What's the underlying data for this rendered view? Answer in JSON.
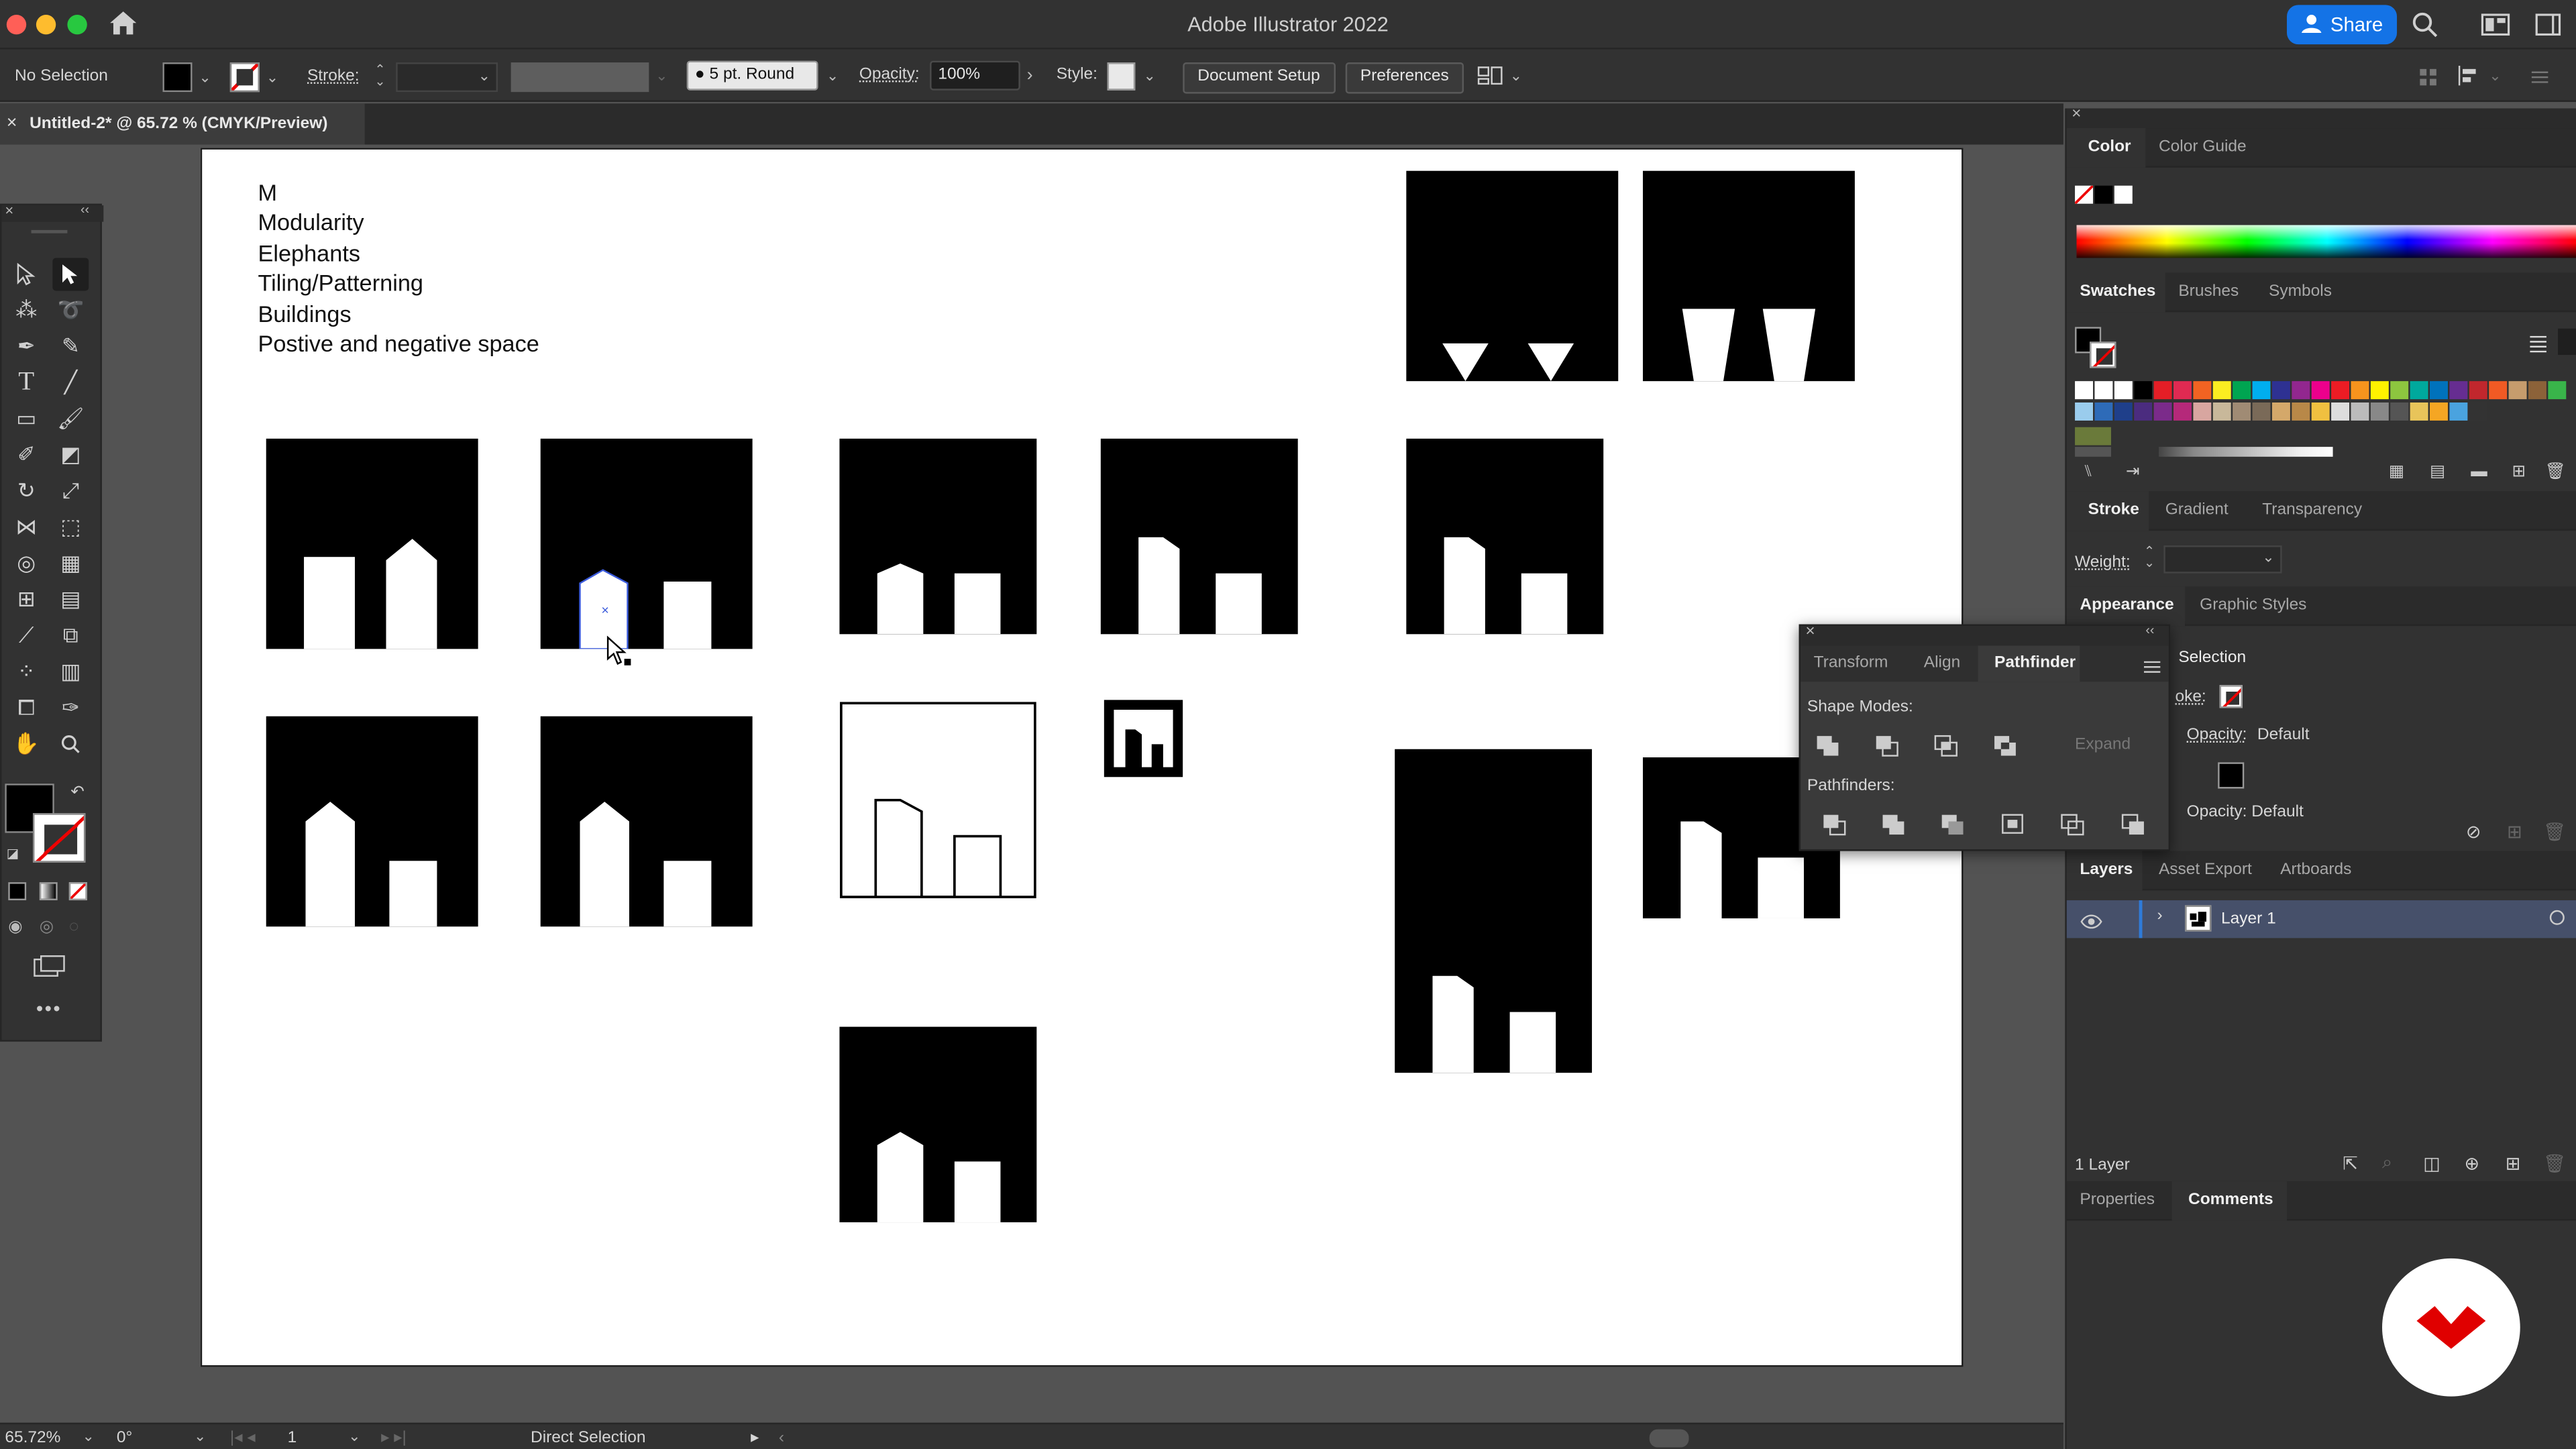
{
  "app": {
    "title": "Adobe Illustrator 2022",
    "share_label": "Share"
  },
  "control": {
    "selection": "No Selection",
    "stroke_label": "Stroke:",
    "brush": "5 pt. Round",
    "opacity_label": "Opacity:",
    "opacity_value": "100%",
    "style_label": "Style:",
    "document_setup": "Document Setup",
    "preferences": "Preferences"
  },
  "document": {
    "tab_title": "Untitled-2* @ 65.72 % (CMYK/Preview)"
  },
  "artboard": {
    "notes": [
      "M",
      "Modularity",
      "Elephants",
      "Tiling/Patterning",
      "Buildings",
      "Postive and negative space"
    ]
  },
  "color_panel": {
    "tabs": [
      "Color",
      "Color Guide"
    ]
  },
  "swatches_panel": {
    "tabs": [
      "Swatches",
      "Brushes",
      "Symbols"
    ]
  },
  "stroke_panel": {
    "tabs": [
      "Stroke",
      "Gradient",
      "Transparency"
    ],
    "weight_label": "Weight:"
  },
  "appearance_panel": {
    "tabs": [
      "Appearance",
      "Graphic Styles"
    ],
    "heading": "Selection",
    "stroke_row": "oke:",
    "opacity_row": "Opacity:",
    "opacity_value": "Default",
    "opacity_row2": "Opacity: Default"
  },
  "pathfinder_panel": {
    "tabs": [
      "Transform",
      "Align",
      "Pathfinder"
    ],
    "shape_modes": "Shape Modes:",
    "expand": "Expand",
    "pathfinders": "Pathfinders:"
  },
  "layers_panel": {
    "tabs": [
      "Layers",
      "Asset Export",
      "Artboards"
    ],
    "layer_name": "Layer 1",
    "count": "1 Layer"
  },
  "bottom_panel": {
    "tabs": [
      "Properties",
      "Comments"
    ]
  },
  "status": {
    "zoom": "65.72%",
    "rotation": "0°",
    "page": "1",
    "tool": "Direct Selection"
  },
  "colors": {
    "accent": "#1473e6",
    "brand_badge": "#e00000"
  }
}
